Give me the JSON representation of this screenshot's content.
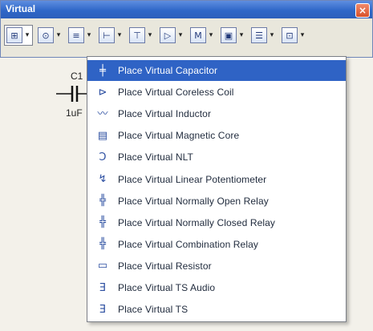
{
  "window": {
    "title": "Virtual"
  },
  "toolbar": {
    "buttons": [
      {
        "icon": "capacitor-icon",
        "glyph": "⊞"
      },
      {
        "icon": "diode-icon",
        "glyph": "⊙"
      },
      {
        "icon": "ground-icon",
        "glyph": "≡"
      },
      {
        "icon": "transistor-icon",
        "glyph": "⊢"
      },
      {
        "icon": "mosfet-icon",
        "glyph": "⊤"
      },
      {
        "icon": "opamp-icon",
        "glyph": "▷"
      },
      {
        "icon": "meter-icon",
        "glyph": "M"
      },
      {
        "icon": "source-icon",
        "glyph": "▣"
      },
      {
        "icon": "misc-icon",
        "glyph": "☰"
      },
      {
        "icon": "more-icon",
        "glyph": "⊡"
      }
    ]
  },
  "schematic": {
    "label_top": "C1",
    "label_bottom": "1uF"
  },
  "menu": {
    "items": [
      {
        "label": "Place Virtual Capacitor",
        "icon": "capacitor-icon",
        "glyph": "╪"
      },
      {
        "label": "Place Virtual Coreless Coil",
        "icon": "coil-icon",
        "glyph": "⊳"
      },
      {
        "label": "Place Virtual Inductor",
        "icon": "inductor-icon",
        "glyph": "〰"
      },
      {
        "label": "Place Virtual Magnetic Core",
        "icon": "magnetic-core-icon",
        "glyph": "▤"
      },
      {
        "label": "Place Virtual NLT",
        "icon": "nlt-icon",
        "glyph": "Ɔ"
      },
      {
        "label": "Place Virtual Linear Potentiometer",
        "icon": "potentiometer-icon",
        "glyph": "↯"
      },
      {
        "label": "Place Virtual Normally Open Relay",
        "icon": "relay-open-icon",
        "glyph": "╬"
      },
      {
        "label": "Place Virtual Normally Closed Relay",
        "icon": "relay-closed-icon",
        "glyph": "╬"
      },
      {
        "label": "Place Virtual Combination Relay",
        "icon": "relay-combination-icon",
        "glyph": "╬"
      },
      {
        "label": "Place Virtual Resistor",
        "icon": "resistor-icon",
        "glyph": "▭"
      },
      {
        "label": "Place Virtual TS Audio",
        "icon": "ts-audio-icon",
        "glyph": "Ǝ"
      },
      {
        "label": "Place Virtual TS",
        "icon": "ts-icon",
        "glyph": "Ǝ"
      }
    ],
    "selected_index": 0
  }
}
